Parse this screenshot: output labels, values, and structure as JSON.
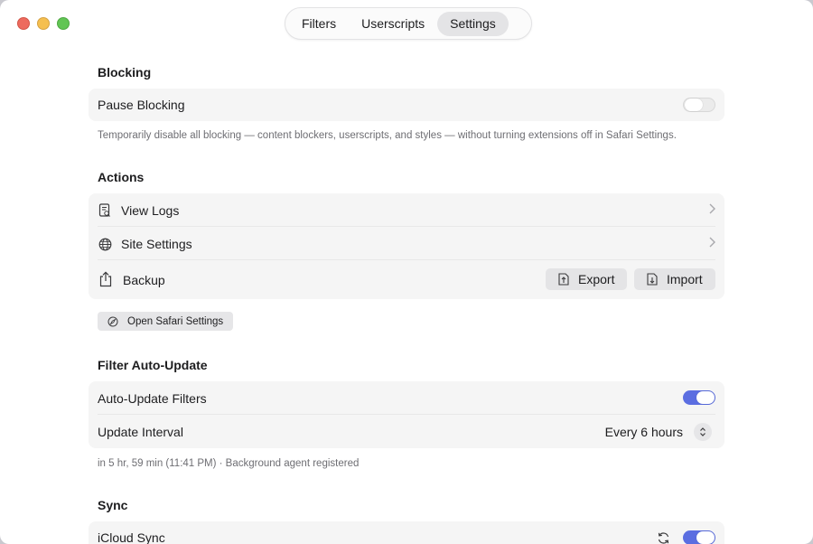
{
  "window": {
    "controls": [
      "close",
      "minimize",
      "zoom"
    ]
  },
  "tabs": [
    {
      "label": "Filters",
      "active": false
    },
    {
      "label": "Userscripts",
      "active": false
    },
    {
      "label": "Settings",
      "active": true
    }
  ],
  "blocking": {
    "title": "Blocking",
    "pause_label": "Pause Blocking",
    "pause_enabled": false,
    "caption": "Temporarily disable all blocking — content blockers, userscripts, and styles — without turning extensions off in Safari Settings."
  },
  "actions": {
    "title": "Actions",
    "view_logs": {
      "label": "View Logs",
      "icon": "logs-icon"
    },
    "site_settings": {
      "label": "Site Settings",
      "icon": "globe-icon"
    },
    "backup": {
      "label": "Backup",
      "icon": "share-icon",
      "export_label": "Export",
      "import_label": "Import"
    },
    "open_safari_label": "Open Safari Settings"
  },
  "auto_update": {
    "title": "Filter Auto-Update",
    "auto_update_label": "Auto-Update Filters",
    "auto_update_enabled": true,
    "interval_label": "Update Interval",
    "interval_value": "Every 6 hours",
    "caption": "in 5 hr, 59 min (11:41 PM) · Background agent registered"
  },
  "sync": {
    "title": "Sync",
    "icloud_label": "iCloud Sync",
    "icloud_enabled": true
  },
  "colors": {
    "accent": "#5b6ee1",
    "card_bg": "#f5f5f5",
    "caption": "#6e6e73"
  }
}
